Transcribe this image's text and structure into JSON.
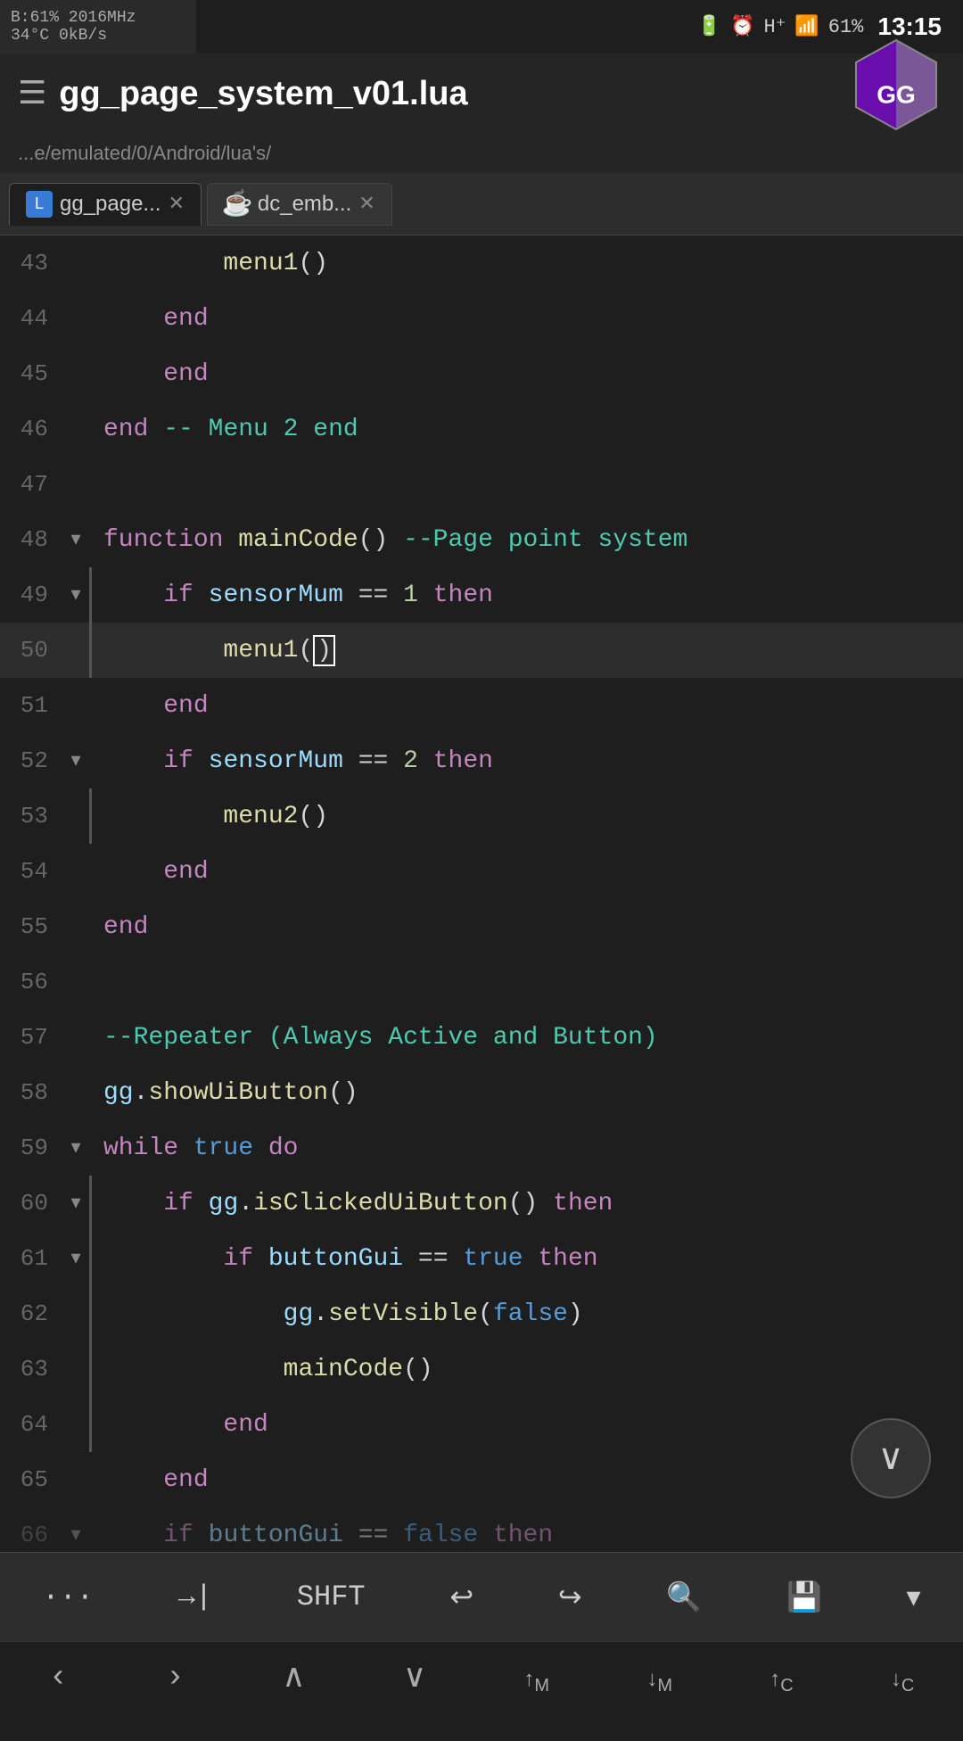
{
  "statusBar": {
    "leftLine1": "B:61% 2016MHz",
    "leftLine2": "34°C 0kB/s",
    "battery": "61%",
    "time": "13:15"
  },
  "titleBar": {
    "title": "gg_page_system_v01.lua",
    "subtitle": "...e/emulated/0/Android/lua's/"
  },
  "tabs": [
    {
      "id": "tab1",
      "label": "gg_page...",
      "icon": "lua",
      "active": true
    },
    {
      "id": "tab2",
      "label": "dc_emb...",
      "icon": "java",
      "active": false
    }
  ],
  "codeLines": [
    {
      "num": "43",
      "indent": 2,
      "hasFold": false,
      "hasBar": false,
      "content": "menu1()"
    },
    {
      "num": "44",
      "indent": 1,
      "hasFold": false,
      "hasBar": false,
      "content": "end"
    },
    {
      "num": "45",
      "indent": 1,
      "hasFold": false,
      "hasBar": false,
      "content": "end"
    },
    {
      "num": "46",
      "indent": 0,
      "hasFold": false,
      "hasBar": false,
      "content": "end -- Menu 2 end"
    },
    {
      "num": "47",
      "indent": 0,
      "hasFold": false,
      "hasBar": false,
      "content": ""
    },
    {
      "num": "48",
      "indent": 0,
      "hasFold": true,
      "hasBar": false,
      "content": "function mainCode() --Page point system"
    },
    {
      "num": "49",
      "indent": 1,
      "hasFold": true,
      "hasBar": true,
      "content": "if sensorMum == 1 then"
    },
    {
      "num": "50",
      "indent": 2,
      "hasFold": false,
      "hasBar": true,
      "content": "menu1()"
    },
    {
      "num": "51",
      "indent": 1,
      "hasFold": false,
      "hasBar": false,
      "content": "end"
    },
    {
      "num": "52",
      "indent": 1,
      "hasFold": true,
      "hasBar": false,
      "content": "if sensorMum == 2 then"
    },
    {
      "num": "53",
      "indent": 2,
      "hasFold": false,
      "hasBar": true,
      "content": "menu2()"
    },
    {
      "num": "54",
      "indent": 1,
      "hasFold": false,
      "hasBar": false,
      "content": "end"
    },
    {
      "num": "55",
      "indent": 0,
      "hasFold": false,
      "hasBar": false,
      "content": "end"
    },
    {
      "num": "56",
      "indent": 0,
      "hasFold": false,
      "hasBar": false,
      "content": ""
    },
    {
      "num": "57",
      "indent": 0,
      "hasFold": false,
      "hasBar": false,
      "content": "--Repeater (Always Active and Button)"
    },
    {
      "num": "58",
      "indent": 0,
      "hasFold": false,
      "hasBar": false,
      "content": "gg.showUiButton()"
    },
    {
      "num": "59",
      "indent": 0,
      "hasFold": true,
      "hasBar": false,
      "content": "while true do"
    },
    {
      "num": "60",
      "indent": 1,
      "hasFold": true,
      "hasBar": true,
      "content": "if gg.isClickedUiButton() then"
    },
    {
      "num": "61",
      "indent": 2,
      "hasFold": true,
      "hasBar": true,
      "content": "if buttonGui == true then"
    },
    {
      "num": "62",
      "indent": 3,
      "hasFold": false,
      "hasBar": true,
      "content": "gg.setVisible(false)"
    },
    {
      "num": "63",
      "indent": 3,
      "hasFold": false,
      "hasBar": true,
      "content": "mainCode()"
    },
    {
      "num": "64",
      "indent": 2,
      "hasFold": false,
      "hasBar": true,
      "content": "end"
    },
    {
      "num": "65",
      "indent": 1,
      "hasFold": false,
      "hasBar": false,
      "content": "end"
    },
    {
      "num": "66",
      "indent": 1,
      "hasFold": true,
      "hasBar": false,
      "content": "if buttonGui == false then"
    }
  ],
  "toolbar": {
    "buttons": [
      "···",
      "→|",
      "SHFT",
      "↩",
      "↪",
      "🔍",
      "💾",
      "▾"
    ]
  },
  "navbar": {
    "buttons": [
      "‹",
      "›",
      "∧",
      "∨",
      "↑M",
      "↓M",
      "↑C",
      "↓C"
    ]
  }
}
